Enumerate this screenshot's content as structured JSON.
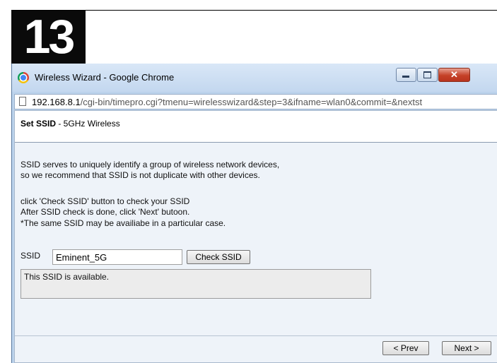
{
  "step": {
    "number": "13"
  },
  "window": {
    "title": "Wireless Wizard - Google Chrome"
  },
  "address": {
    "host": "192.168.8.1",
    "path": "/cgi-bin/timepro.cgi?tmenu=wirelesswizard&step=3&ifname=wlan0&commit=&nextst"
  },
  "panel": {
    "title_bold": "Set SSID",
    "title_rest": " - 5GHz Wireless"
  },
  "description": {
    "line1": "SSID serves to uniquely identify a group of wireless network devices,",
    "line2": "so we recommend that SSID is not duplicate with other devices.",
    "line3": "click 'Check SSID' button to check your SSID",
    "line4": "After SSID check is done, click 'Next' butoon.",
    "line5": "*The same SSID may be availiabe in a particular case."
  },
  "ssid": {
    "label": "SSID",
    "value": "Eminent_5G",
    "check_button": "Check SSID",
    "status": "This SSID is available."
  },
  "nav": {
    "prev": "< Prev",
    "next": "Next >"
  },
  "icons": {
    "browser": "chrome-logo-icon",
    "page": "page-icon",
    "minimize": "minimize-icon",
    "maximize": "maximize-icon",
    "close": "close-icon"
  },
  "colors": {
    "window_frame": "#bcd3ec",
    "content_bg": "#eef3f9",
    "close_button": "#c54128",
    "step_badge": "#0a0a0a"
  }
}
